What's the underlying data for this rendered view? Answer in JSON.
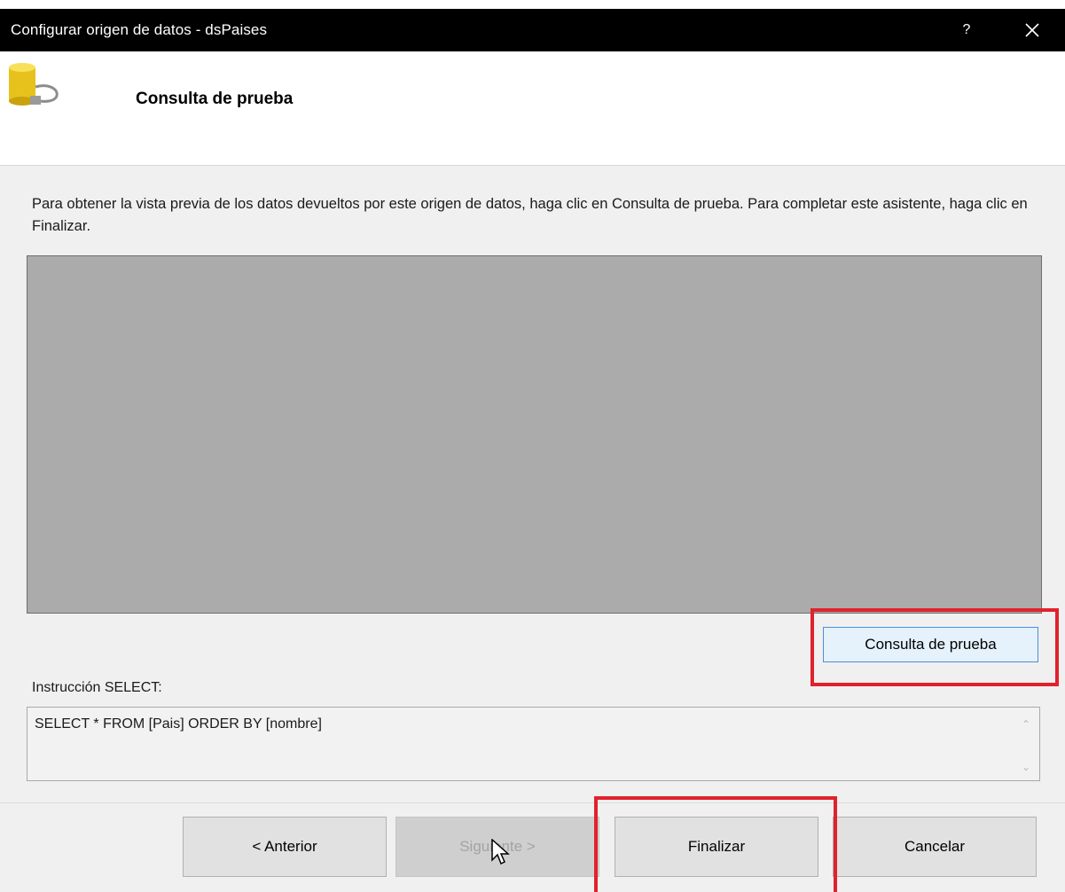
{
  "window": {
    "title": "Configurar origen de datos - dsPaises",
    "help_label": "?"
  },
  "header": {
    "icon": "database-connection-icon",
    "title": "Consulta de prueba"
  },
  "content": {
    "description": "Para obtener la vista previa de los datos devueltos por este origen de datos, haga clic en Consulta de prueba. Para completar este asistente, haga clic en Finalizar.",
    "test_query_button": "Consulta de prueba",
    "select_label": "Instrucción SELECT:",
    "select_statement": "SELECT * FROM [Pais] ORDER BY [nombre]"
  },
  "buttons": {
    "previous": "< Anterior",
    "next": "Siguiente >",
    "finish": "Finalizar",
    "cancel": "Cancelar"
  },
  "colors": {
    "highlight": "#e0222d",
    "preview_background": "#ababab",
    "title_bar": "#000000"
  }
}
